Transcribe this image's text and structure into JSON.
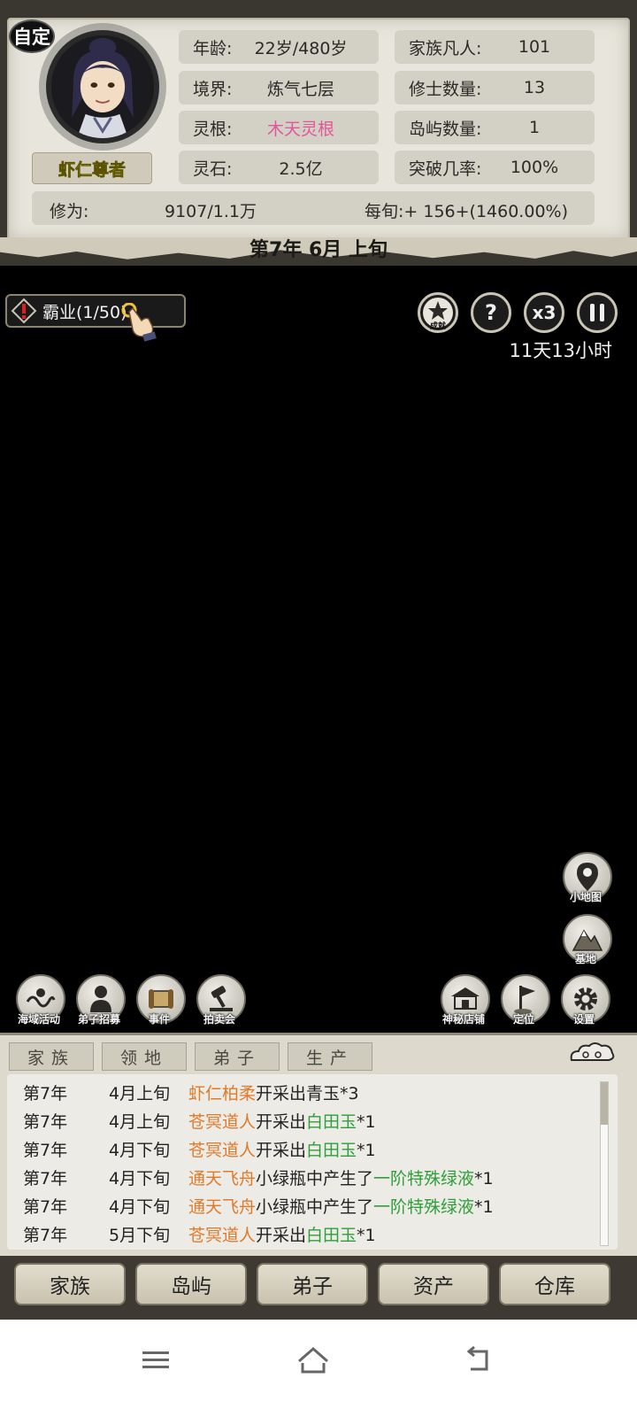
{
  "header": {
    "auto_badge": "自定",
    "player_title": "虾仁尊者",
    "date": "第7年 6月 上旬"
  },
  "stats": {
    "age": {
      "label": "年龄:",
      "value": "22岁/480岁"
    },
    "realm": {
      "label": "境界:",
      "value": "炼气七层"
    },
    "root": {
      "label": "灵根:",
      "value": "木天灵根"
    },
    "stones": {
      "label": "灵石:",
      "value": "2.5亿"
    },
    "family": {
      "label": "家族凡人:",
      "value": "101"
    },
    "cultivators": {
      "label": "修士数量:",
      "value": "13"
    },
    "islands": {
      "label": "岛屿数量:",
      "value": "1"
    },
    "breakthrough": {
      "label": "突破几率:",
      "value": "100%"
    },
    "cultivation": {
      "label": "修为:",
      "value": "9107/1.1万",
      "rate": "每旬:+ 156+(1460.00%)"
    }
  },
  "colors": {
    "root_value": "#e2569a",
    "name_plate": "#f3e200",
    "log_orange": "#e07a2b",
    "log_green": "#2f9e3a"
  },
  "quest": {
    "label": "霸业(1/50)"
  },
  "controls": {
    "achievement_label": "成就",
    "help": "?",
    "speed": "x3",
    "pause": "pause-icon",
    "countdown": "11天13小时"
  },
  "side_buttons": {
    "minimap": "小地图",
    "base": "基地"
  },
  "bottom_left_buttons": [
    "海域活动",
    "弟子招募",
    "事件",
    "拍卖会"
  ],
  "bottom_right_buttons": [
    "神秘店铺",
    "定位",
    "设置"
  ],
  "log_tabs": [
    "家族",
    "领地",
    "弟子",
    "生产"
  ],
  "log_entries": [
    {
      "year": "第7年",
      "period": "4月上旬",
      "actor": "虾仁柏柔",
      "action": "开采出",
      "item": "青玉",
      "count": "*3",
      "item_color": "plain"
    },
    {
      "year": "第7年",
      "period": "4月上旬",
      "actor": "苍冥道人",
      "action": "开采出",
      "item": "白田玉",
      "count": "*1",
      "item_color": "green"
    },
    {
      "year": "第7年",
      "period": "4月下旬",
      "actor": "苍冥道人",
      "action": "开采出",
      "item": "白田玉",
      "count": "*1",
      "item_color": "green"
    },
    {
      "year": "第7年",
      "period": "4月下旬",
      "actor": "通天飞舟",
      "action": "小绿瓶中产生了",
      "item": "一阶特殊绿液",
      "count": "*1",
      "item_color": "green"
    },
    {
      "year": "第7年",
      "period": "4月下旬",
      "actor": "通天飞舟",
      "action": "小绿瓶中产生了",
      "item": "一阶特殊绿液",
      "count": "*1",
      "item_color": "green"
    },
    {
      "year": "第7年",
      "period": "5月下旬",
      "actor": "苍冥道人",
      "action": "开采出",
      "item": "白田玉",
      "count": "*1",
      "item_color": "green"
    }
  ],
  "nav": [
    "家族",
    "岛屿",
    "弟子",
    "资产",
    "仓库"
  ],
  "system_bar": {
    "menu": "menu-icon",
    "home": "home-icon",
    "back": "back-icon"
  }
}
